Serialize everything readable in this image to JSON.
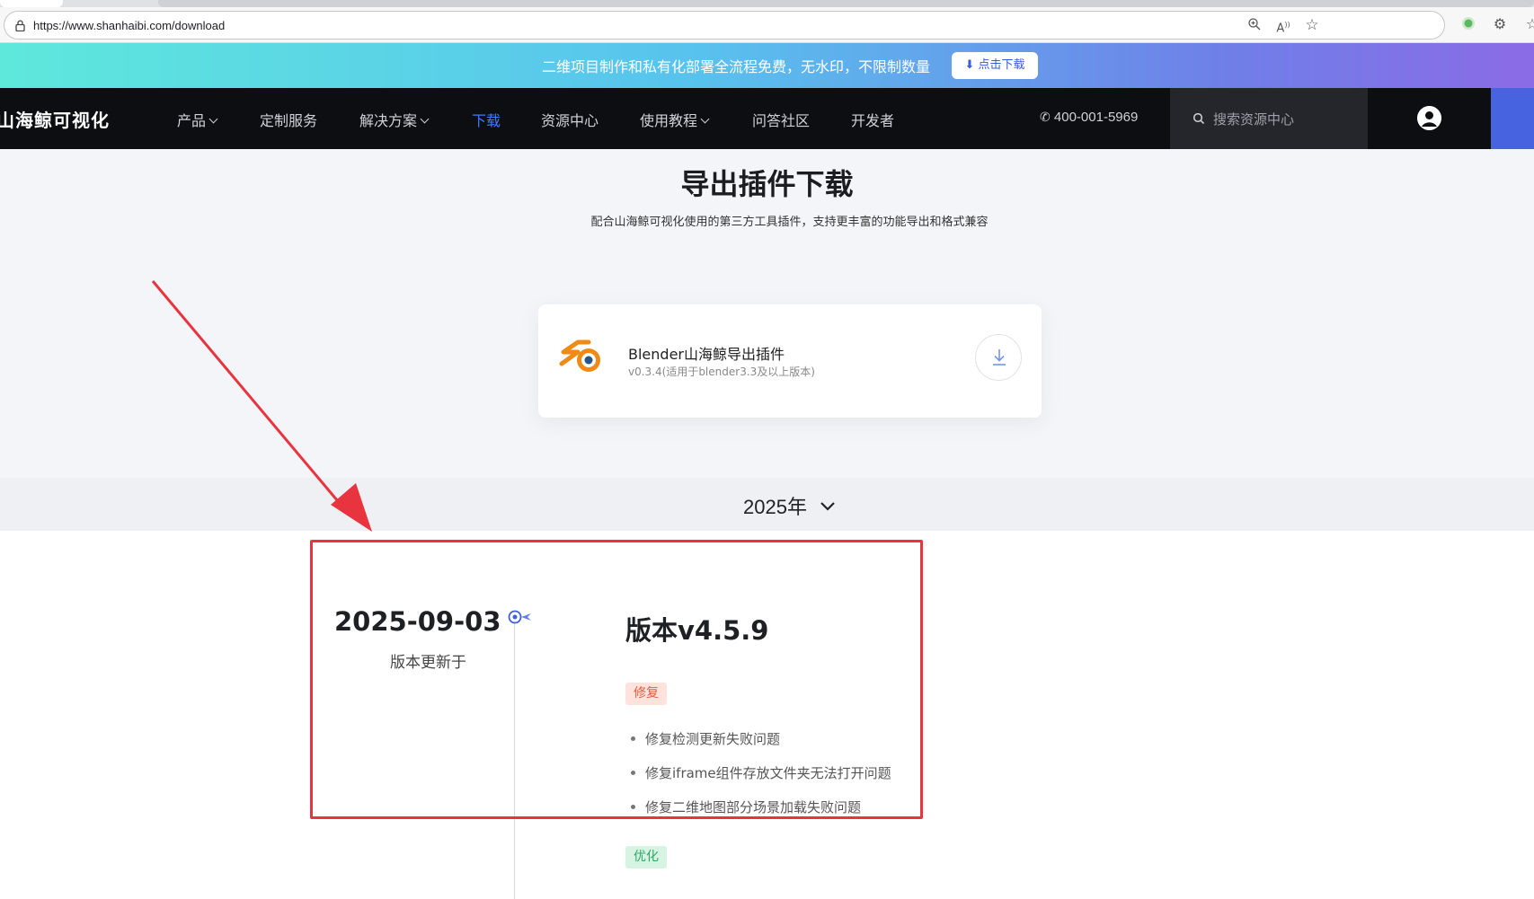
{
  "browser": {
    "url": "https://www.shanhaibi.com/download"
  },
  "promo": {
    "text": "二维项目制作和私有化部署全流程免费，无水印，不限制数量",
    "button": "点击下载"
  },
  "nav": {
    "logo": "山海鲸可视化",
    "items": [
      {
        "label": "产品",
        "dropdown": true
      },
      {
        "label": "定制服务",
        "dropdown": false
      },
      {
        "label": "解决方案",
        "dropdown": true
      },
      {
        "label": "下载",
        "dropdown": false,
        "active": true
      },
      {
        "label": "资源中心",
        "dropdown": false
      },
      {
        "label": "使用教程",
        "dropdown": true
      },
      {
        "label": "问答社区",
        "dropdown": false
      },
      {
        "label": "开发者",
        "dropdown": false
      }
    ],
    "phone": "400-001-5969",
    "search_placeholder": "搜索资源中心"
  },
  "hero": {
    "title": "导出插件下载",
    "subtitle": "配合山海鲸可视化使用的第三方工具插件，支持更丰富的功能导出和格式兼容"
  },
  "plugin": {
    "name": "Blender山海鲸导出插件",
    "version": "v0.3.4(适用于blender3.3及以上版本)"
  },
  "year_selector": {
    "value": "2025年"
  },
  "release": {
    "date": "2025-09-03",
    "date_label": "版本更新于",
    "version": "版本v4.5.9",
    "fix_tag": "修复",
    "fix_items": [
      "修复检测更新失败问题",
      "修复iframe组件存放文件夹无法打开问题",
      "修复二维地图部分场景加载失败问题"
    ],
    "optimize_tag": "优化"
  },
  "colors": {
    "annotation_red": "#e8343f",
    "nav_bg": "#0d0e12",
    "accent_blue": "#3d7bff"
  }
}
